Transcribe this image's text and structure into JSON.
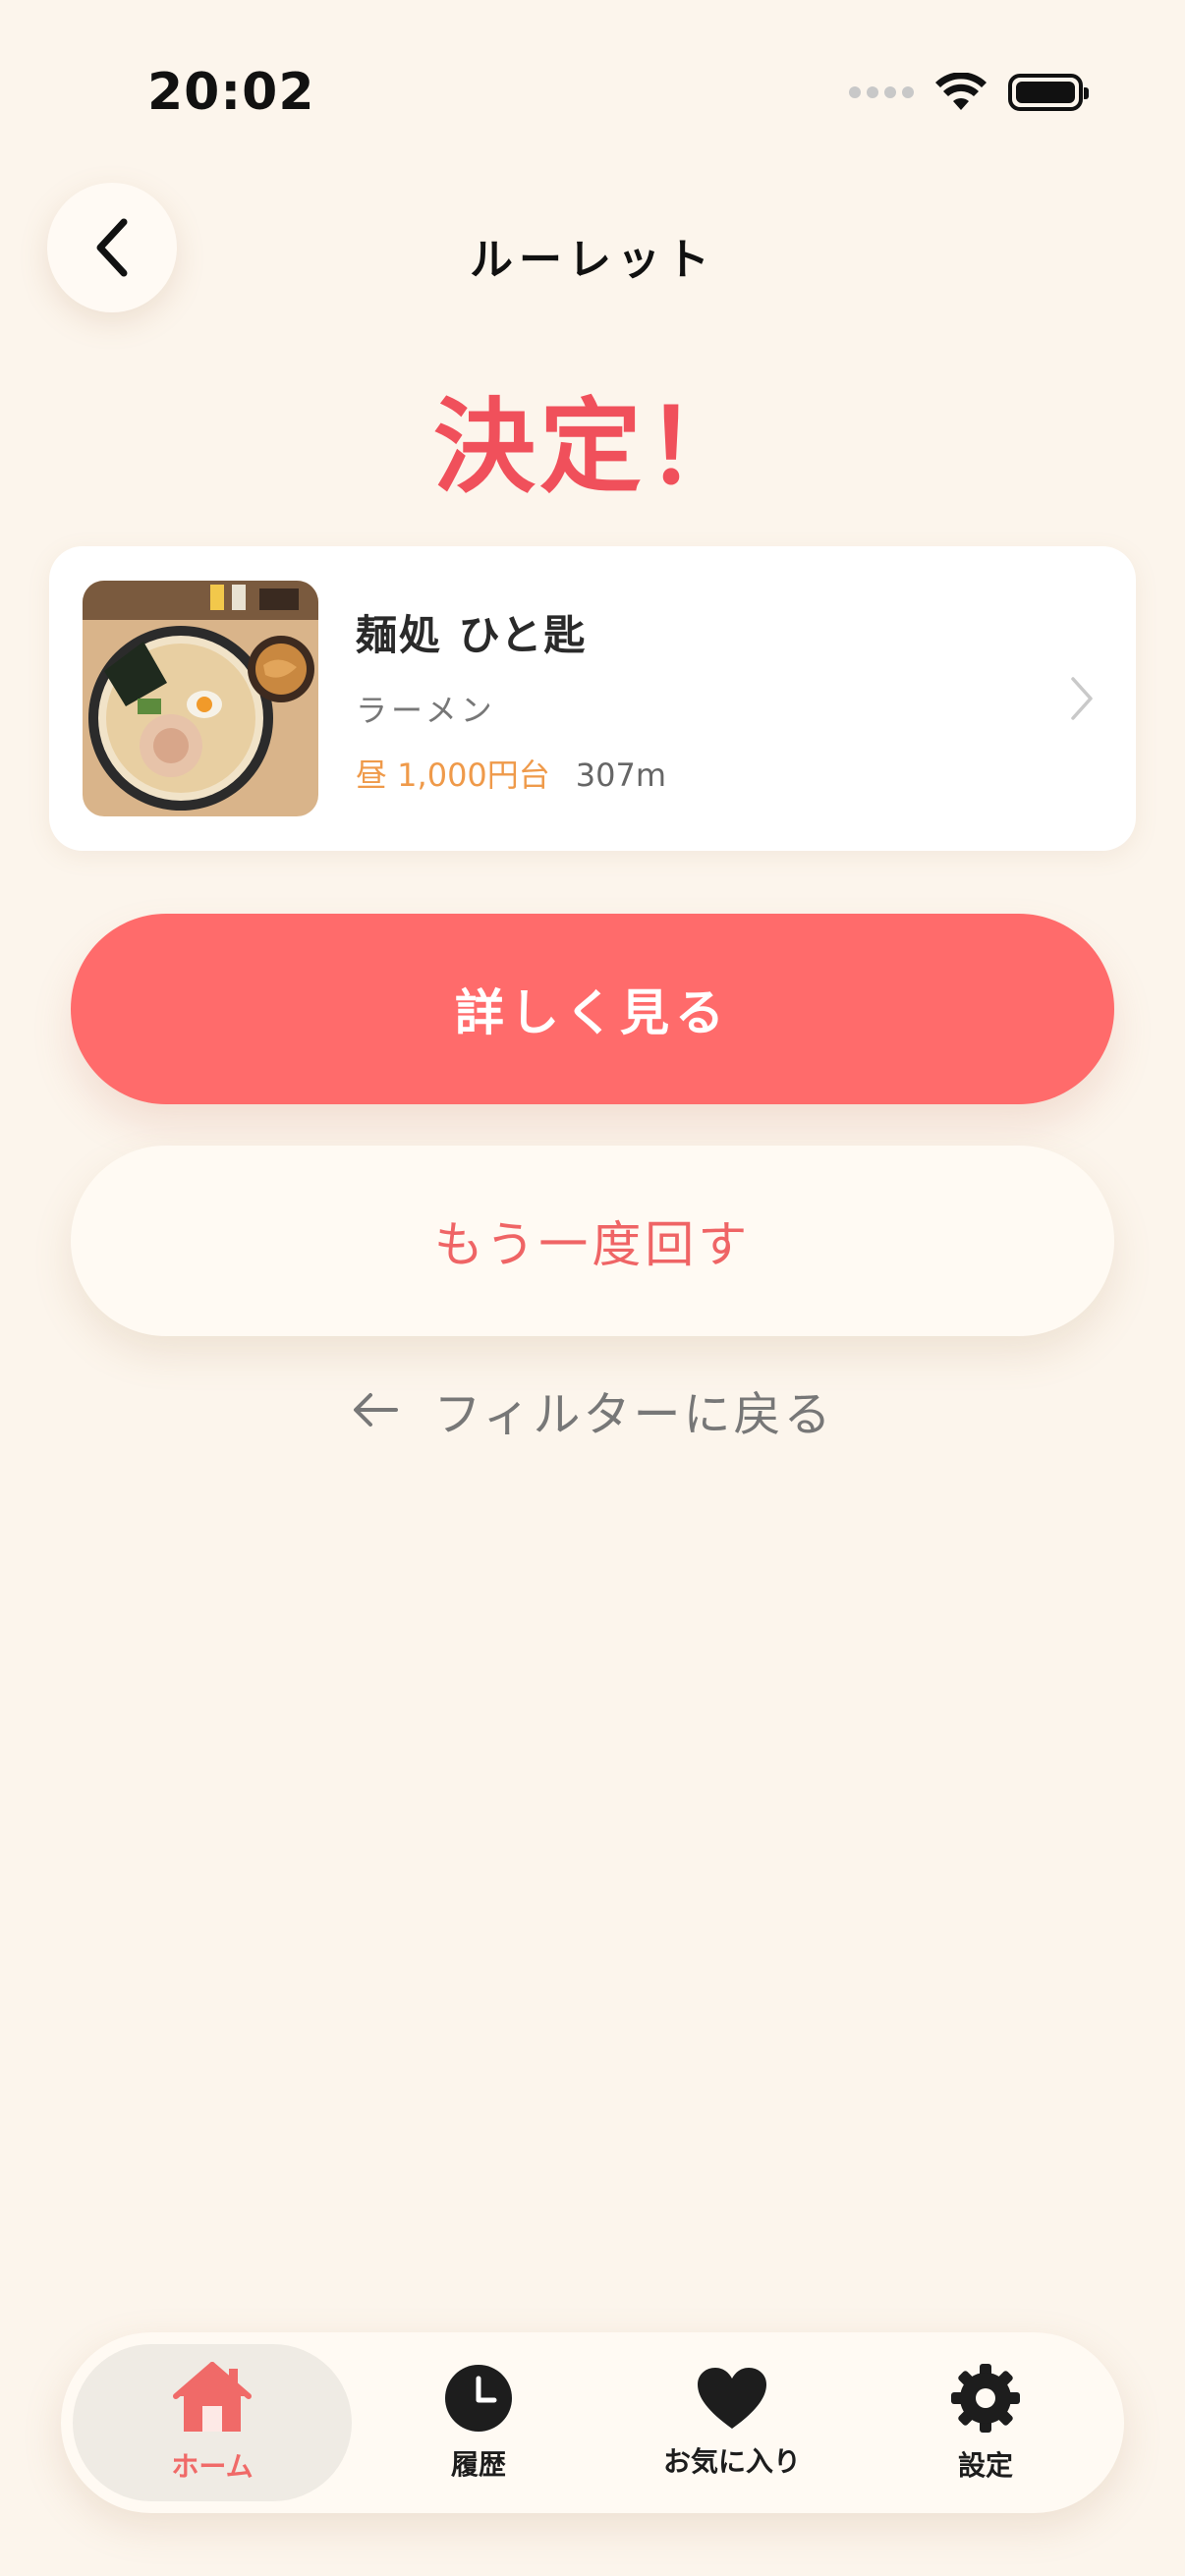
{
  "status_bar": {
    "time": "20:02"
  },
  "header": {
    "title": "ルーレット"
  },
  "result": {
    "heading": "決定！",
    "shop_name": "麺処 ひと匙",
    "genre": "ラーメン",
    "price": "昼 1,000円台",
    "distance": "307m"
  },
  "actions": {
    "detail_label": "詳しく見る",
    "spin_again_label": "もう一度回す",
    "back_to_filter_label": "フィルターに戻る"
  },
  "tabs": [
    {
      "label": "ホーム",
      "icon": "home-icon",
      "active": true
    },
    {
      "label": "履歴",
      "icon": "clock-icon",
      "active": false
    },
    {
      "label": "お気に入り",
      "icon": "heart-icon",
      "active": false
    },
    {
      "label": "設定",
      "icon": "gear-icon",
      "active": false
    }
  ],
  "colors": {
    "background": "#fcf5ec",
    "accent": "#ff6b6b",
    "heading": "#f0505b",
    "price": "#ef9a4a"
  }
}
